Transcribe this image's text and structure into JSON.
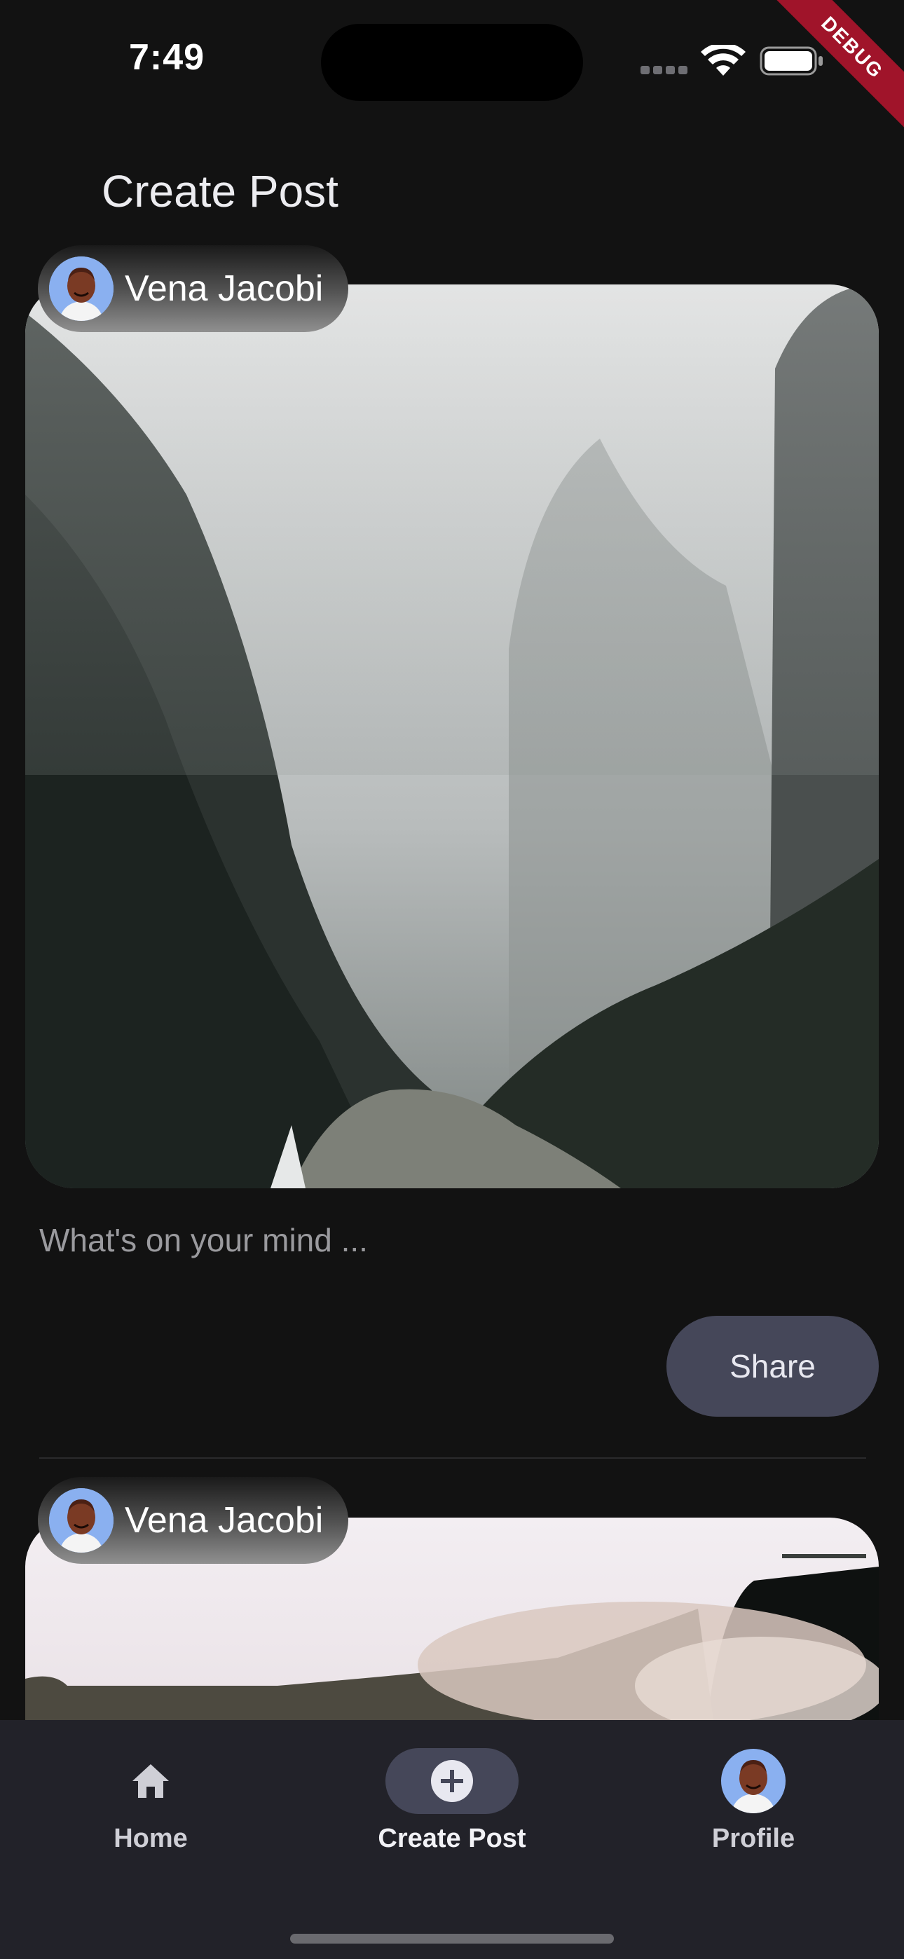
{
  "status_bar": {
    "time": "7:49",
    "debug_label": "DEBUG"
  },
  "header": {
    "title": "Create Post"
  },
  "posts": [
    {
      "author": "Vena Jacobi"
    },
    {
      "author": "Vena Jacobi"
    }
  ],
  "composer": {
    "placeholder": "What's on your mind ...",
    "share_label": "Share"
  },
  "bottom_nav": {
    "items": [
      {
        "label": "Home",
        "icon": "home-icon",
        "active": false
      },
      {
        "label": "Create Post",
        "icon": "add-circle-icon",
        "active": true
      },
      {
        "label": "Profile",
        "icon": "avatar",
        "active": false
      }
    ]
  },
  "colors": {
    "background": "#121212",
    "nav_background": "#222229",
    "active_pill": "#454759",
    "debug_ribbon": "#a0142a"
  }
}
